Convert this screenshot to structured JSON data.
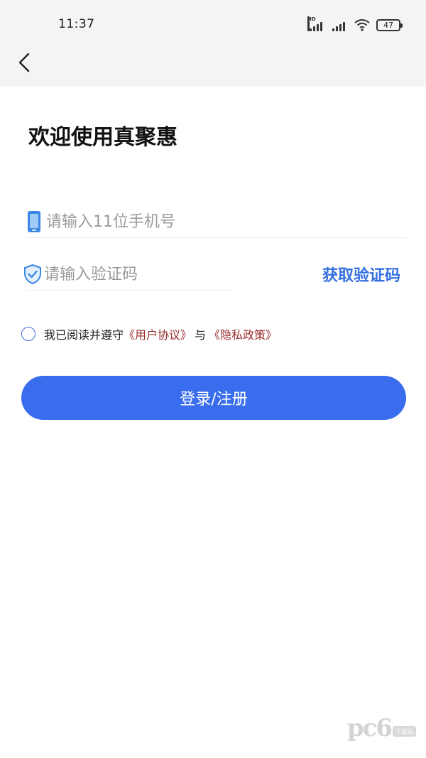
{
  "status_bar": {
    "time": "11:37",
    "network_badge": "HD",
    "battery_level": "47"
  },
  "page": {
    "title": "欢迎使用真聚惠"
  },
  "form": {
    "phone_placeholder": "请输入11位手机号",
    "code_placeholder": "请输入验证码",
    "get_code_label": "获取验证码"
  },
  "agreement": {
    "prefix": "我已阅读并遵守",
    "user_agreement": "《用户协议》",
    "conjunction": "与",
    "privacy_policy": "《隐私政策》"
  },
  "actions": {
    "login_label": "登录/注册"
  },
  "watermark": {
    "logo": "pc6",
    "tag": "下载站"
  },
  "colors": {
    "primary": "#3a6ded",
    "link_red": "#9b2d2d",
    "header_bg": "#f4f4f4"
  },
  "icons": {
    "back": "chevron-left-icon",
    "phone": "mobile-phone-icon",
    "code": "shield-check-icon"
  }
}
